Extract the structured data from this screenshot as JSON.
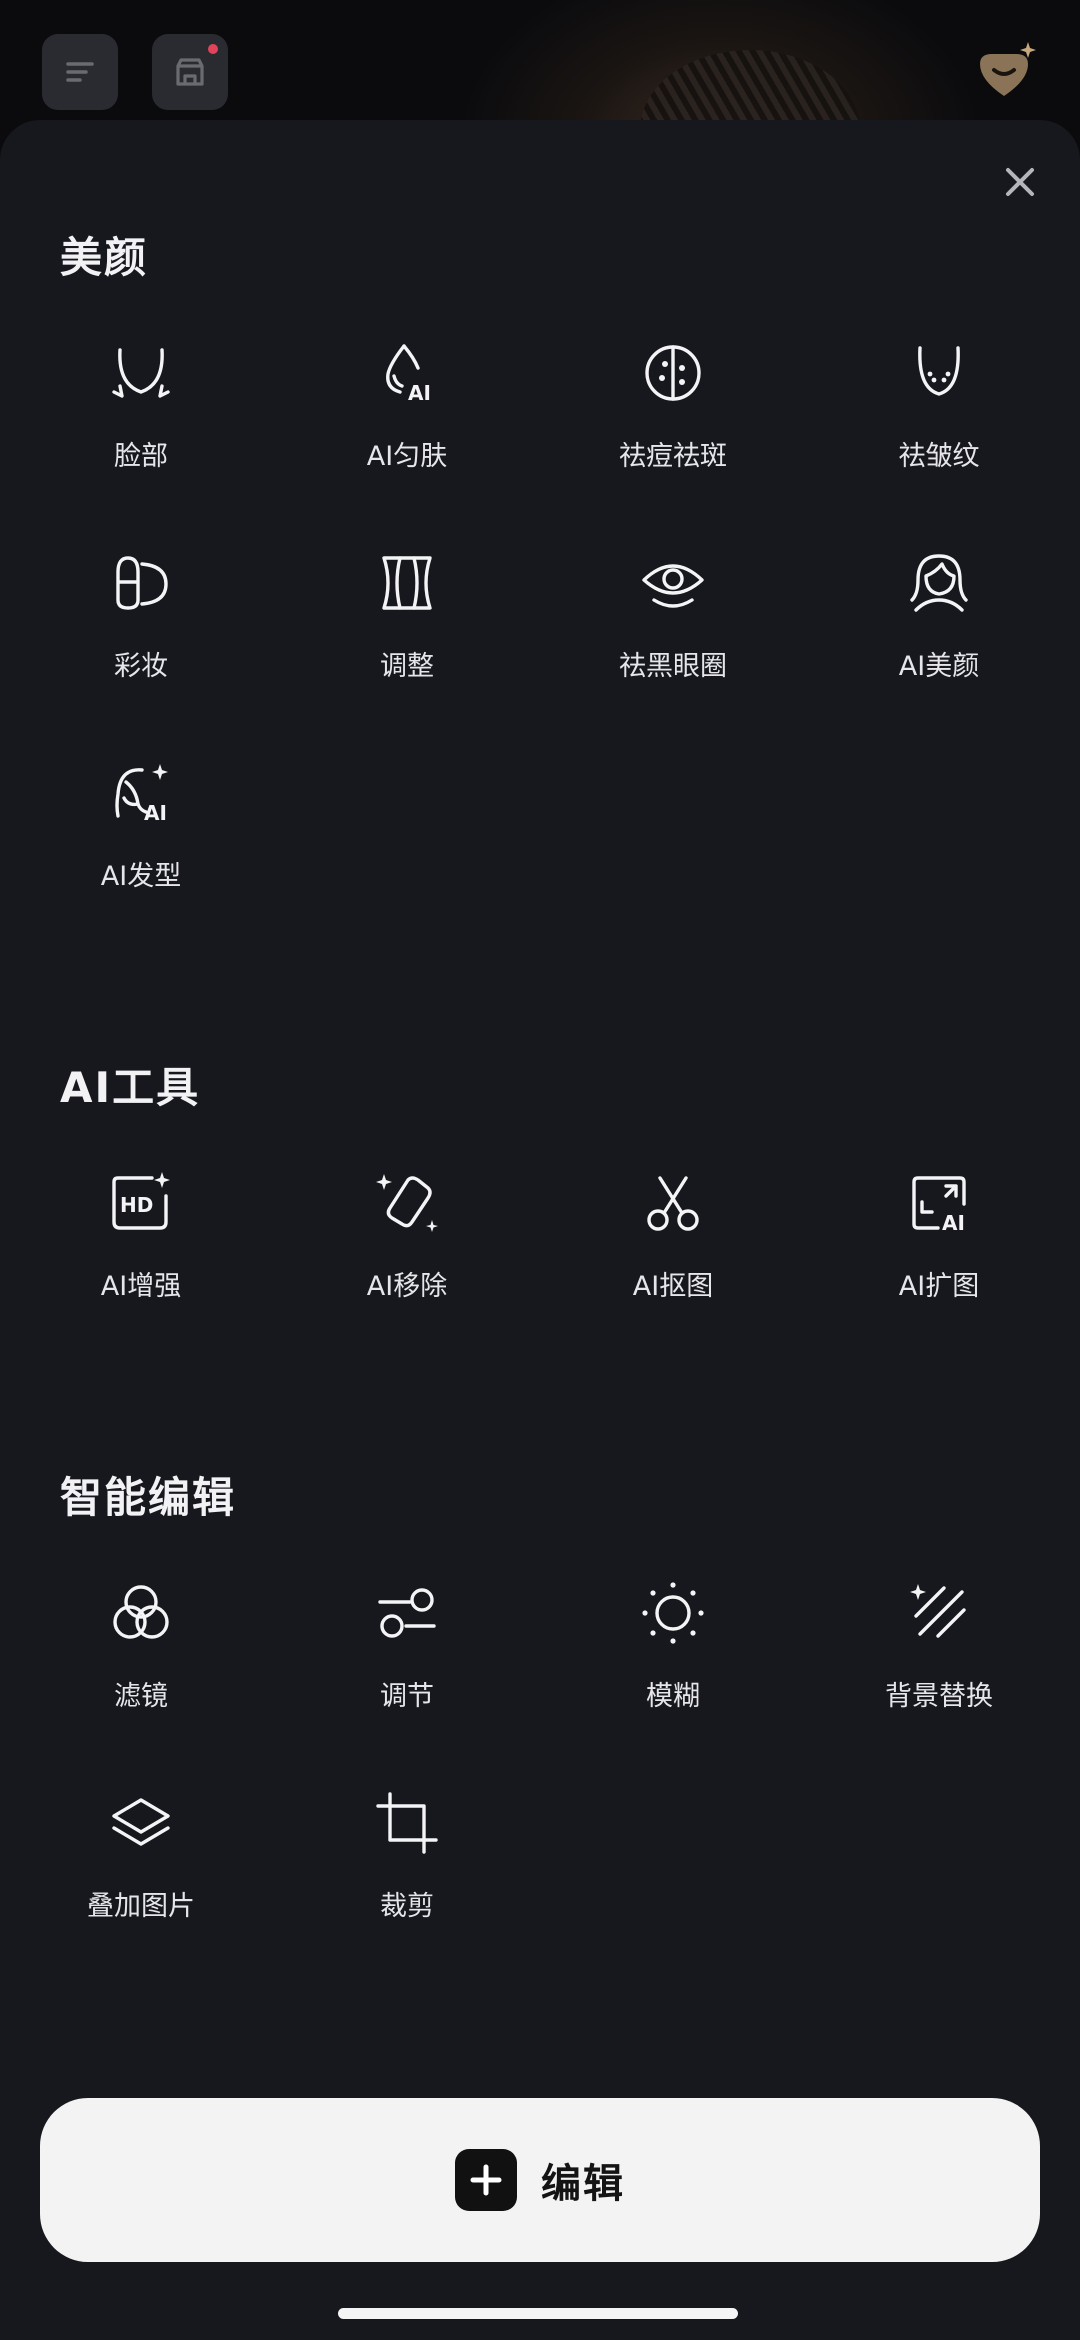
{
  "colors": {
    "sheet": "#17181d",
    "accent_dot": "#e0445a",
    "premium": "#b89b78",
    "button_bg": "#f3f3f4"
  },
  "header": {
    "menu_icon": "menu-icon",
    "store_icon": "store-icon",
    "premium_icon": "premium-badge-icon"
  },
  "sheet": {
    "close_icon": "close-icon",
    "sections": [
      {
        "title": "美颜",
        "tools": [
          {
            "label": "脸部",
            "icon": "face-outline-icon"
          },
          {
            "label": "AI匀肤",
            "icon": "ai-drop-icon"
          },
          {
            "label": "祛痘祛斑",
            "icon": "acne-circle-icon"
          },
          {
            "label": "祛皱纹",
            "icon": "wrinkle-face-icon"
          },
          {
            "label": "彩妆",
            "icon": "makeup-icon"
          },
          {
            "label": "调整",
            "icon": "body-shape-icon"
          },
          {
            "label": "祛黑眼圈",
            "icon": "eye-icon"
          },
          {
            "label": "AI美颜",
            "icon": "ai-portrait-icon"
          },
          {
            "label": "AI发型",
            "icon": "ai-hair-icon"
          }
        ]
      },
      {
        "title": "AI工具",
        "tools": [
          {
            "label": "AI增强",
            "icon": "hd-enhance-icon",
            "badge": "HD"
          },
          {
            "label": "AI移除",
            "icon": "eraser-icon"
          },
          {
            "label": "AI抠图",
            "icon": "scissors-icon"
          },
          {
            "label": "AI扩图",
            "icon": "expand-ai-icon"
          }
        ]
      },
      {
        "title": "智能编辑",
        "tools": [
          {
            "label": "滤镜",
            "icon": "filter-circles-icon"
          },
          {
            "label": "调节",
            "icon": "adjust-sliders-icon"
          },
          {
            "label": "模糊",
            "icon": "blur-sun-icon"
          },
          {
            "label": "背景替换",
            "icon": "background-lines-icon"
          },
          {
            "label": "叠加图片",
            "icon": "layers-icon"
          },
          {
            "label": "裁剪",
            "icon": "crop-icon"
          }
        ]
      }
    ],
    "ai_text": "AI"
  },
  "edit_button": {
    "label": "编辑",
    "icon": "plus-icon"
  }
}
